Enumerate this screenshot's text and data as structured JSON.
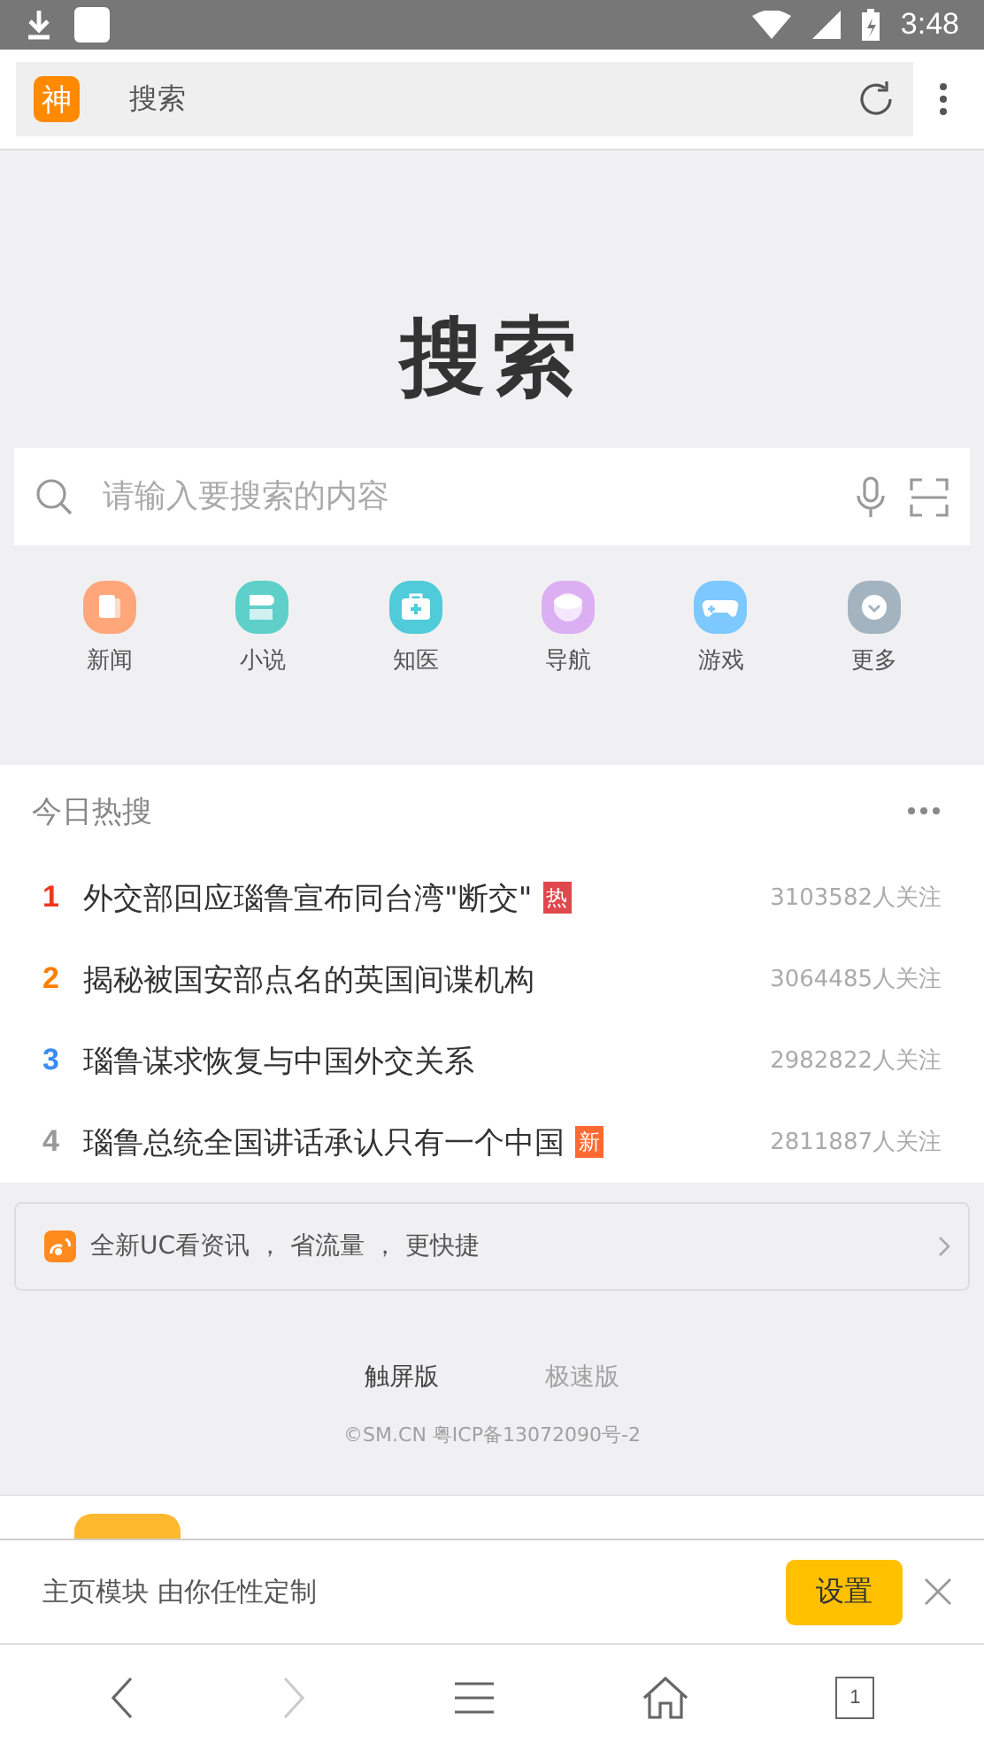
{
  "status_bar": {
    "time": "3:48"
  },
  "address_bar": {
    "logo": "神",
    "title": "搜索"
  },
  "logo_title": "搜索",
  "search": {
    "placeholder": "请输入要搜索的内容"
  },
  "shortcuts": [
    {
      "label": "新闻",
      "color": "#ffa67a",
      "kind": "news"
    },
    {
      "label": "小说",
      "color": "#5ecfc9",
      "kind": "novel"
    },
    {
      "label": "知医",
      "color": "#50cbd9",
      "kind": "medical"
    },
    {
      "label": "导航",
      "color": "#dcaef2",
      "kind": "nav"
    },
    {
      "label": "游戏",
      "color": "#7cc8ff",
      "kind": "game"
    },
    {
      "label": "更多",
      "color": "#a3b3bf",
      "kind": "more"
    }
  ],
  "hot": {
    "title": "今日热搜",
    "items": [
      {
        "rank": "1",
        "color": "#f2361c",
        "title": "外交部回应瑙鲁宣布同台湾\"断交\"",
        "badge": {
          "text": "热",
          "color": "#e0484e"
        },
        "followers": "3103582人关注"
      },
      {
        "rank": "2",
        "color": "#ff7e00",
        "title": "揭秘被国安部点名的英国间谍机构",
        "followers": "3064485人关注"
      },
      {
        "rank": "3",
        "color": "#3a8cf2",
        "title": "瑙鲁谋求恢复与中国外交关系",
        "followers": "2982822人关注"
      },
      {
        "rank": "4",
        "color": "#999999",
        "title": "瑙鲁总统全国讲话承认只有一个中国",
        "badge": {
          "text": "新",
          "color": "#ff6a33"
        },
        "followers": "2811887人关注"
      }
    ]
  },
  "promo": {
    "text": "全新UC看资讯 ， 省流量 ， 更快捷"
  },
  "versions": [
    {
      "label": "触屏版",
      "selected": true
    },
    {
      "label": "极速版",
      "selected": false
    }
  ],
  "copyright": "©SM.CN 粤ICP备13072090号-2",
  "tip": {
    "text": "主页模块 由你任性定制",
    "button": "设置"
  },
  "tabs_count": "1"
}
